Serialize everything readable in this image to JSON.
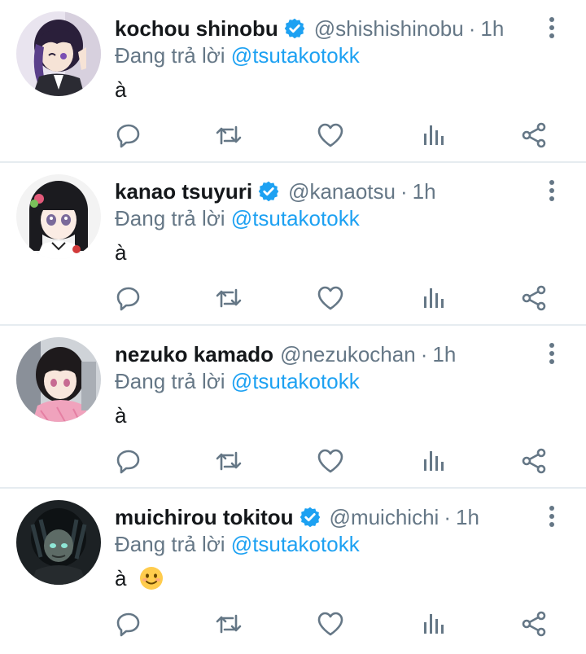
{
  "reply_prefix": "Đang trả lời",
  "colors": {
    "accent": "#1da1f2",
    "text_primary": "#14171a",
    "text_secondary": "#657786",
    "divider": "#e6ecf0"
  },
  "icons": {
    "verified": "verified-badge-icon",
    "more": "more-vertical-icon",
    "reply": "reply-icon",
    "retweet": "retweet-icon",
    "like": "heart-icon",
    "analytics": "analytics-icon",
    "share": "share-icon"
  },
  "tweets": [
    {
      "display_name": "kochou shinobu",
      "verified": true,
      "handle": "@shishishinobu",
      "separator": "·",
      "time": "1h",
      "mention": "@tsutakotokk",
      "text": "à",
      "emoji": ""
    },
    {
      "display_name": "kanao tsuyuri",
      "verified": true,
      "handle": "@kanaotsu",
      "separator": "·",
      "time": "1h",
      "mention": "@tsutakotokk",
      "text": "à",
      "emoji": ""
    },
    {
      "display_name": "nezuko kamado",
      "verified": false,
      "handle": "@nezukochan",
      "separator": "·",
      "time": "1h",
      "mention": "@tsutakotokk",
      "text": "à",
      "emoji": ""
    },
    {
      "display_name": "muichirou tokitou",
      "verified": true,
      "handle": "@muichichi",
      "separator": "·",
      "time": "1h",
      "mention": "@tsutakotokk",
      "text": "à",
      "emoji": "smiling-face-emoji"
    }
  ]
}
